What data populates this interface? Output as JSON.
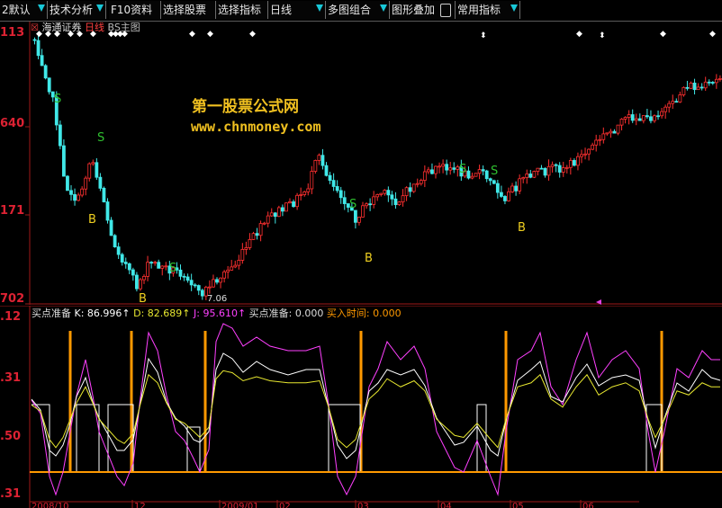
{
  "toolbar": {
    "items": [
      {
        "label": "2默认",
        "dropdown": true
      },
      {
        "label": "技术分析",
        "dropdown": true
      },
      {
        "label": "F10资料",
        "dropdown": false
      },
      {
        "label": "选择股票",
        "dropdown": false
      },
      {
        "label": "选择指标",
        "dropdown": false
      },
      {
        "label": "日线",
        "dropdown": true
      },
      {
        "label": "多图组合",
        "dropdown": true
      },
      {
        "label": "图形叠加",
        "dropdown": false
      },
      {
        "label": "常用指标",
        "dropdown": true
      }
    ]
  },
  "price_panel": {
    "stock_name": "海通证券",
    "period": "日线",
    "main_chart": "BS主图",
    "y_labels": [
      "113",
      "640",
      "171",
      "702"
    ],
    "low_marker": "7.06",
    "signal_s": "S",
    "signal_b": "B",
    "watermark_title": "第一股票公式网",
    "watermark_url": "www.chnmoney.com"
  },
  "indicator_panel": {
    "title": "买点准备",
    "k_label": "K: 86.996↑",
    "d_label": "D: 82.689↑",
    "j_label": "J: 95.610↑",
    "prep_label": "买点准备: 0.000",
    "time_label": "买入时间: 0.000",
    "y_labels": [
      ".12",
      ".31",
      ".50",
      ".31"
    ],
    "x_labels": [
      "2008/10",
      "12",
      "2009/01",
      "02",
      "03",
      "04",
      "05",
      "06"
    ]
  },
  "colors": {
    "up": "#ff3030",
    "down": "#40e8e8",
    "k_line": "#ffffff",
    "d_line": "#e8e830",
    "j_line": "#ff40ff",
    "signal": "#ff9900",
    "label_red": "#d82222"
  }
}
